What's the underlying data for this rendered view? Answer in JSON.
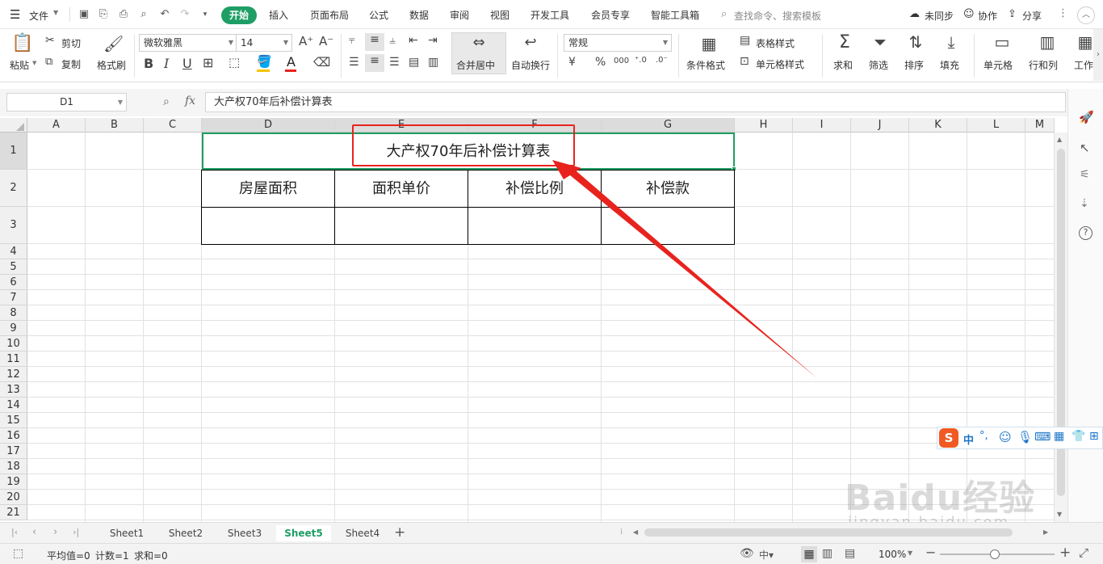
{
  "menubar": {
    "file": "文件",
    "tabs": [
      "开始",
      "插入",
      "页面布局",
      "公式",
      "数据",
      "审阅",
      "视图",
      "开发工具",
      "会员专享",
      "智能工具箱"
    ],
    "search": "查找命令、搜索模板",
    "sync": "未同步",
    "collab": "协作",
    "share": "分享"
  },
  "ribbon": {
    "paste": "粘贴",
    "cut": "剪切",
    "copy": "复制",
    "format_painter": "格式刷",
    "font_name": "微软雅黑",
    "font_size": "14",
    "merge_center": "合并居中",
    "wrap": "自动换行",
    "number_format": "常规",
    "cond_format": "条件格式",
    "table_style": "表格样式",
    "cell_style": "单元格样式",
    "sum": "求和",
    "filter": "筛选",
    "sort": "排序",
    "fill": "填充",
    "cell": "单元格",
    "rowcol": "行和列",
    "worksheet": "工作"
  },
  "formula_bar": {
    "name_box": "D1",
    "fx": "fx",
    "content": "大产权70年后补偿计算表"
  },
  "columns": [
    "A",
    "B",
    "C",
    "D",
    "E",
    "F",
    "G",
    "H",
    "I",
    "J",
    "K",
    "L",
    "M"
  ],
  "rows": [
    "1",
    "2",
    "3",
    "4",
    "5",
    "6",
    "7",
    "8",
    "9",
    "10",
    "11",
    "12",
    "13",
    "14",
    "15",
    "16",
    "17",
    "18",
    "19",
    "20",
    "21"
  ],
  "table": {
    "title": "大产权70年后补偿计算表",
    "headers": [
      "房屋面积",
      "面积单价",
      "补偿比例",
      "补偿款"
    ]
  },
  "sheets": [
    "Sheet1",
    "Sheet2",
    "Sheet3",
    "Sheet5",
    "Sheet4"
  ],
  "active_sheet": "Sheet5",
  "status": {
    "average": "平均值=0",
    "count": "计数=1",
    "sum": "求和=0",
    "zoom": "100%"
  },
  "ime": {
    "mode": "中"
  },
  "watermark": {
    "brand": "Baidu经验",
    "url": "jingyan.baidu.com"
  },
  "colors": {
    "accent": "#1e9e65",
    "annotation": "#e8231e"
  }
}
